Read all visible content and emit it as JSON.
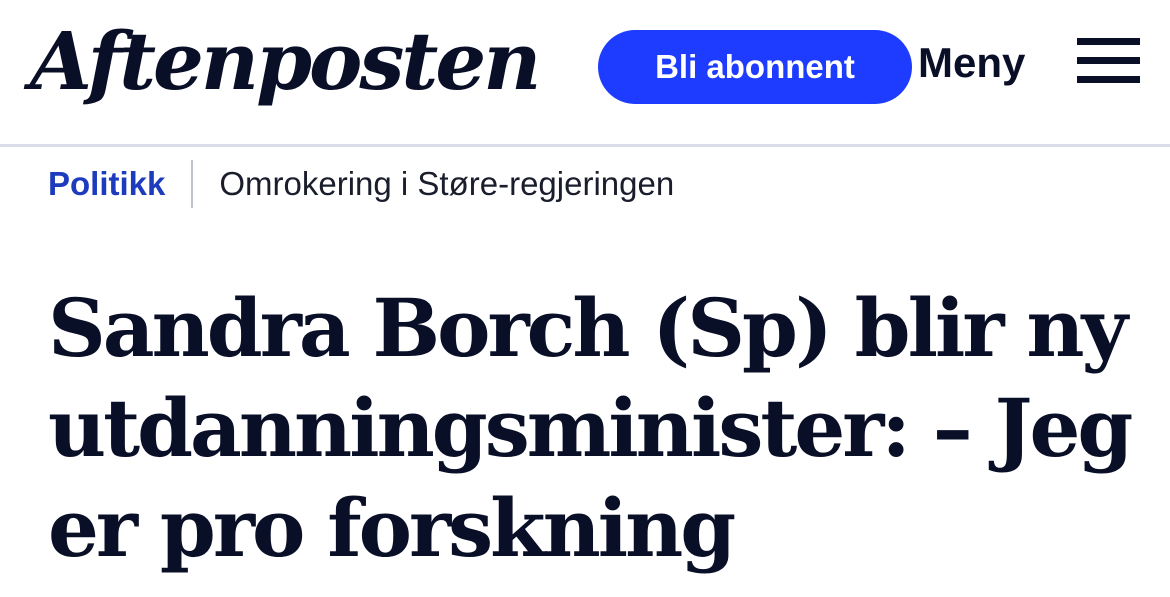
{
  "header": {
    "logo_text": "Aftenposten",
    "subscribe_label": "Bli abonnent",
    "menu_label": "Meny",
    "menu_icon": "hamburger-icon"
  },
  "breadcrumb": {
    "section": "Politikk",
    "topic": "Omrokering i Støre-regjeringen"
  },
  "article": {
    "headline": "Sandra Borch (Sp) blir ny utdanningsminister: – Jeg er pro forskning"
  },
  "colors": {
    "brand_blue": "#1d3cff",
    "section_blue": "#1d3cbd",
    "text_dark": "#0a0f28",
    "divider": "#d9dde8"
  }
}
